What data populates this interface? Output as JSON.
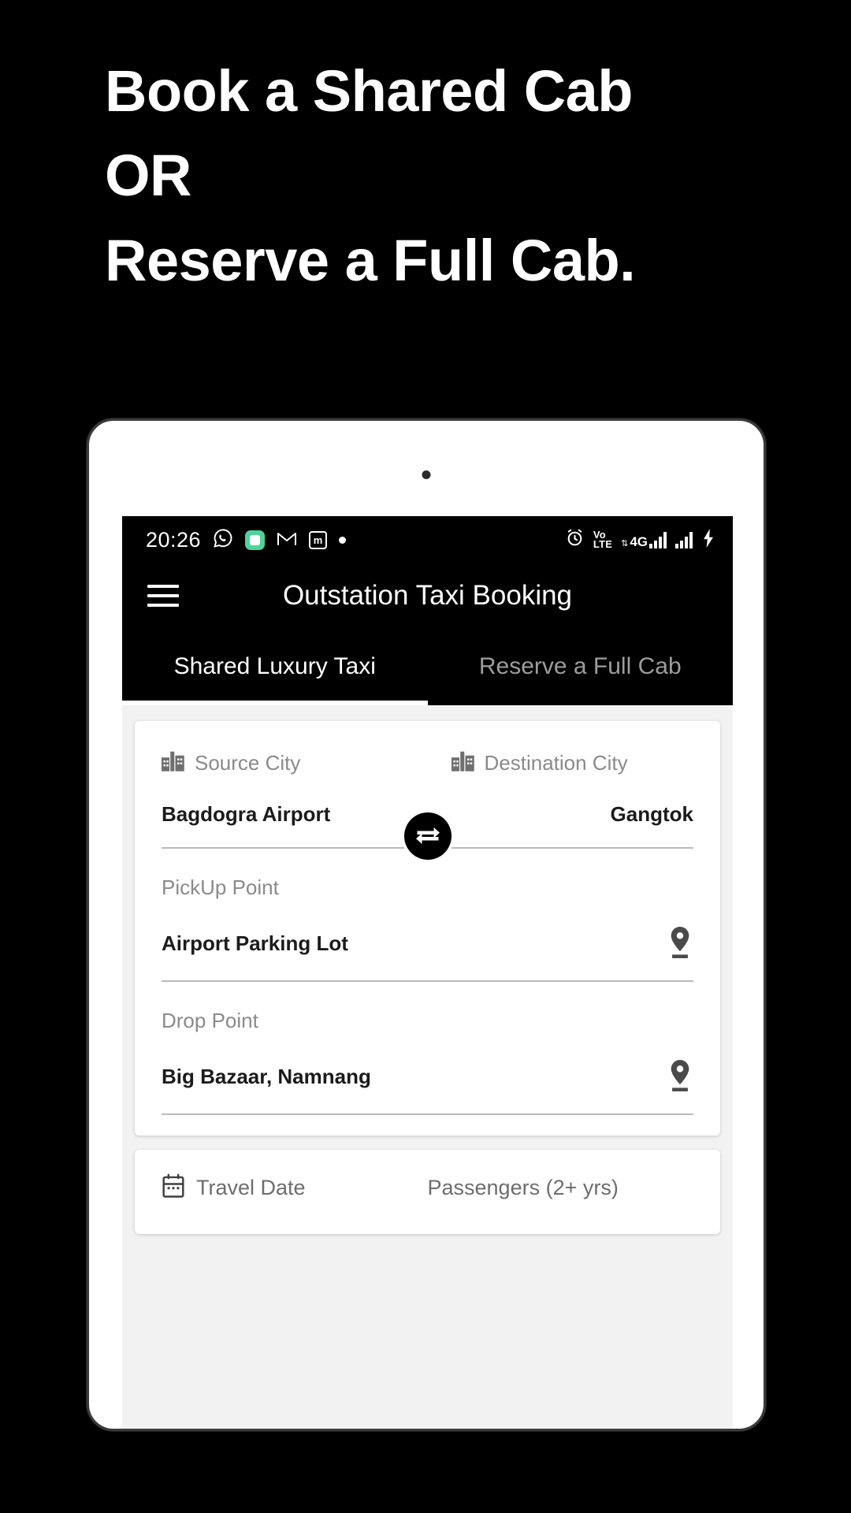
{
  "headline": {
    "lines": [
      "Book a Shared Cab",
      "OR",
      "Reserve a Full Cab."
    ]
  },
  "colors": {
    "background": "#000000",
    "appbar": "#000000",
    "accent": "#ffffff",
    "body": "#f2f2f2",
    "card": "#ffffff",
    "label": "#8a8a8a",
    "value": "#1b1b1b",
    "green_app": "#4fd39a"
  },
  "statusbar": {
    "time": "20:26",
    "left_icons": [
      "whatsapp-icon",
      "green-app-icon",
      "gmail-icon",
      "m-app-icon",
      "dot-icon"
    ],
    "right_icons": [
      "alarm-icon",
      "volte-icon",
      "signal-4g-icon",
      "signal-bars-icon",
      "charging-icon"
    ],
    "volte_top": "Vo",
    "volte_bottom": "LTE",
    "network_label": "4G",
    "m_app_letter": "m"
  },
  "appbar": {
    "menu_icon": "hamburger-icon",
    "title": "Outstation Taxi Booking"
  },
  "tabs": [
    {
      "label": "Shared Luxury Taxi",
      "active": true
    },
    {
      "label": "Reserve a Full Cab",
      "active": false
    }
  ],
  "form": {
    "source": {
      "label": "Source City",
      "value": "Bagdogra Airport",
      "icon": "building-icon"
    },
    "destination": {
      "label": "Destination City",
      "value": "Gangtok",
      "icon": "building-icon"
    },
    "swap_button": "swap-icon",
    "pickup": {
      "label": "PickUp Point",
      "value": "Airport Parking Lot",
      "icon": "map-pin-icon"
    },
    "drop": {
      "label": "Drop Point",
      "value": "Big Bazaar, Namnang",
      "icon": "map-pin-icon"
    }
  },
  "bottom_card": {
    "travel_date_label": "Travel Date",
    "travel_date_icon": "calendar-icon",
    "passengers_label": "Passengers (2+ yrs)"
  }
}
